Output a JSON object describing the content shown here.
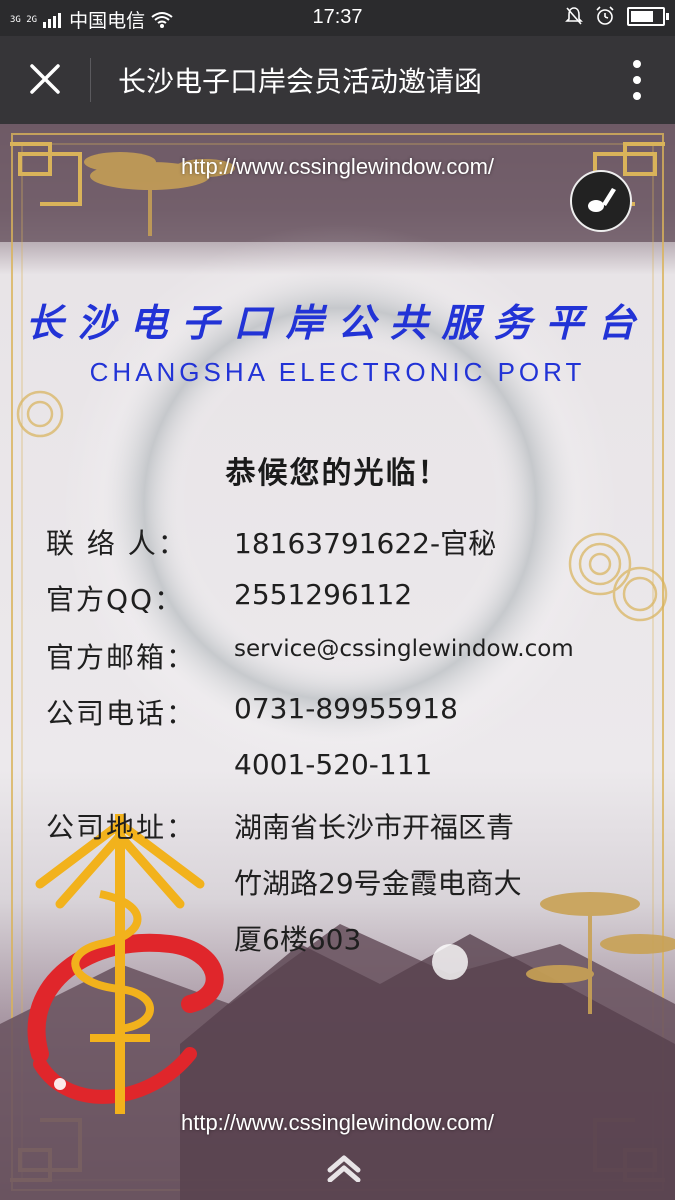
{
  "status_bar": {
    "network": "3G 2G",
    "carrier": "中国电信",
    "time": "17:37",
    "battery_level": 0.85
  },
  "title_bar": {
    "title": "长沙电子口岸会员活动邀请函"
  },
  "invitation": {
    "url_top": "http://www.cssinglewindow.com/",
    "url_bottom": "http://www.cssinglewindow.com/",
    "heading_cn": "长沙电子口岸公共服务平台",
    "heading_en": "CHANGSHA ELECTRONIC PORT",
    "welcome": "恭候您的光临！",
    "contact": [
      {
        "label": "联 络 人：",
        "value": "18163791622-官秘"
      },
      {
        "label": "官方QQ：",
        "value": "2551296112"
      },
      {
        "label": "官方邮箱：",
        "value": "service@cssinglewindow.com"
      },
      {
        "label": "公司电话：",
        "value": "0731-89955918"
      },
      {
        "label": "",
        "value": "4001-520-111"
      },
      {
        "label": "公司地址：",
        "value": "湖南省长沙市开福区青"
      },
      {
        "label": "",
        "value": "竹湖路29号金霞电商大"
      },
      {
        "label": "",
        "value": "厦6楼603"
      }
    ]
  },
  "colors": {
    "heading_blue": "#2233d6",
    "status_bar_bg": "#2b2b2d",
    "title_bar_bg": "#363538",
    "gold_ornament": "#d9b35a",
    "logo_red": "#e0262b",
    "logo_gold": "#f2b21c"
  },
  "icons": {
    "close": "close-icon",
    "more": "more-vertical-icon",
    "music": "music-note-icon",
    "scroll_up": "chevron-up-icon",
    "wifi": "wifi-icon",
    "alarm": "alarm-icon",
    "silent": "bell-off-icon"
  }
}
